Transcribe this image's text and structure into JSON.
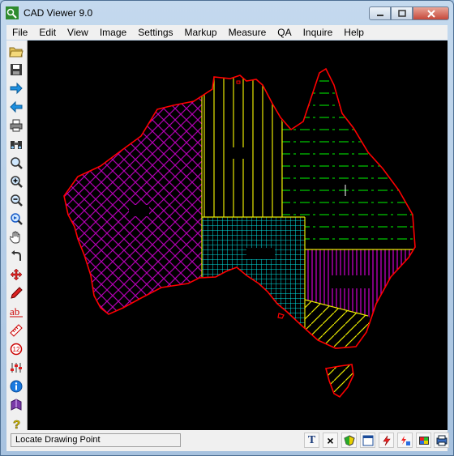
{
  "window": {
    "title": "CAD Viewer 9.0"
  },
  "menu": [
    "File",
    "Edit",
    "View",
    "Image",
    "Settings",
    "Markup",
    "Measure",
    "QA",
    "Inquire",
    "Help"
  ],
  "status": {
    "text": "Locate Drawing Point"
  },
  "status_buttons": [
    {
      "name": "text-tool-button",
      "glyph": "T"
    },
    {
      "name": "delete-button",
      "glyph": "×"
    }
  ],
  "colors": {
    "canvas_bg": "#000000",
    "outline": "#ff0000",
    "wa_hatch": "#b000b0",
    "nt_hatch": "#e8e800",
    "qld_hatch": "#00c000",
    "sa_hatch": "#00e0e0",
    "nsw_hatch": "#c000c0",
    "vic_hatch": "#e8e800",
    "tas_hatch": "#e8e800"
  }
}
